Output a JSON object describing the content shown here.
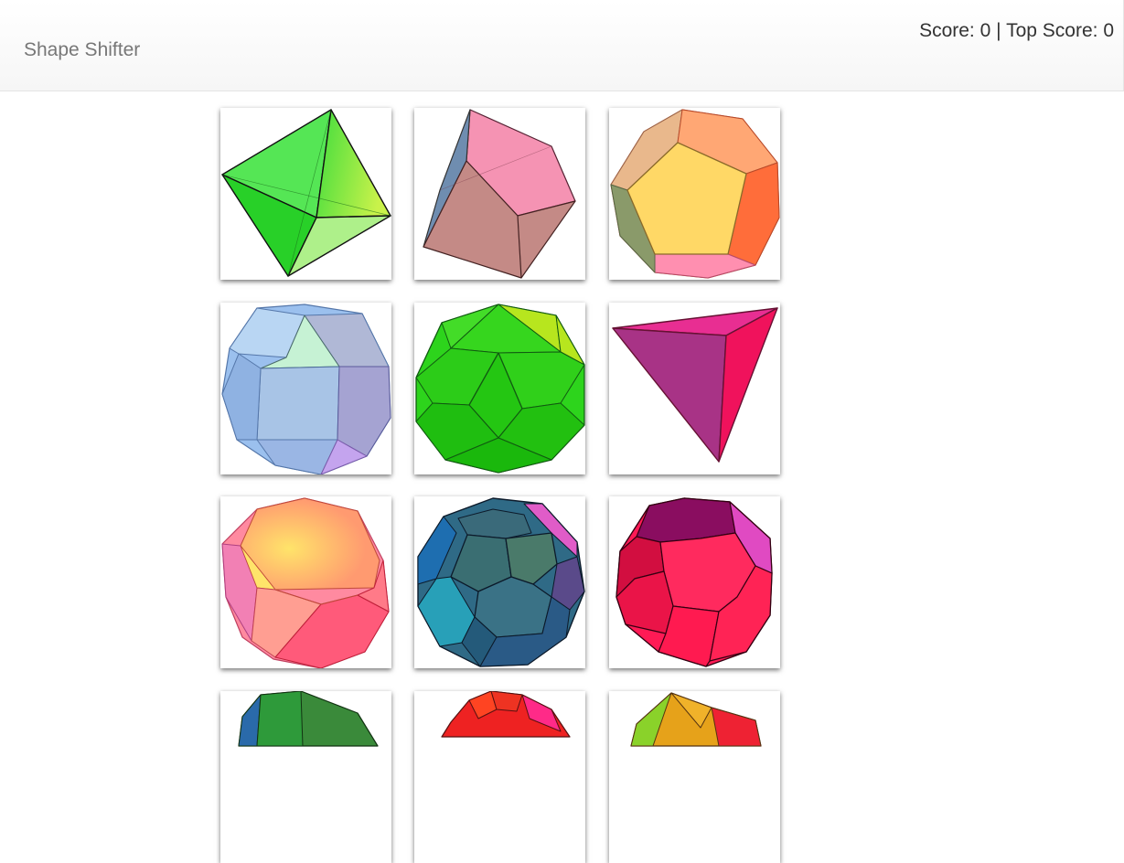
{
  "navbar": {
    "brand": "Shape Shifter",
    "score_label": "Score:",
    "score": 0,
    "separator": "|",
    "top_score_label": "Top Score:",
    "top_score": 0
  },
  "cards": [
    {
      "shape": "octahedron",
      "color": "#33dd33"
    },
    {
      "shape": "cube",
      "color": "#d4687a"
    },
    {
      "shape": "dodecahedron",
      "color": "#ff9a55"
    },
    {
      "shape": "rhombicuboctahedron",
      "color": "#8ab2e6"
    },
    {
      "shape": "icosidodecahedron",
      "color": "#22cc11"
    },
    {
      "shape": "tetrahedron",
      "color": "#c0307f"
    },
    {
      "shape": "truncated-octahedron",
      "color": "#ff7a6a"
    },
    {
      "shape": "truncated-icosahedron",
      "color": "#3a7a8e"
    },
    {
      "shape": "truncated-octahedron",
      "color": "#ee1144"
    },
    {
      "shape": "partial-green",
      "color": "#2f9a3a"
    },
    {
      "shape": "partial-red",
      "color": "#ee2222"
    },
    {
      "shape": "partial-yellow",
      "color": "#e6a21a"
    }
  ]
}
